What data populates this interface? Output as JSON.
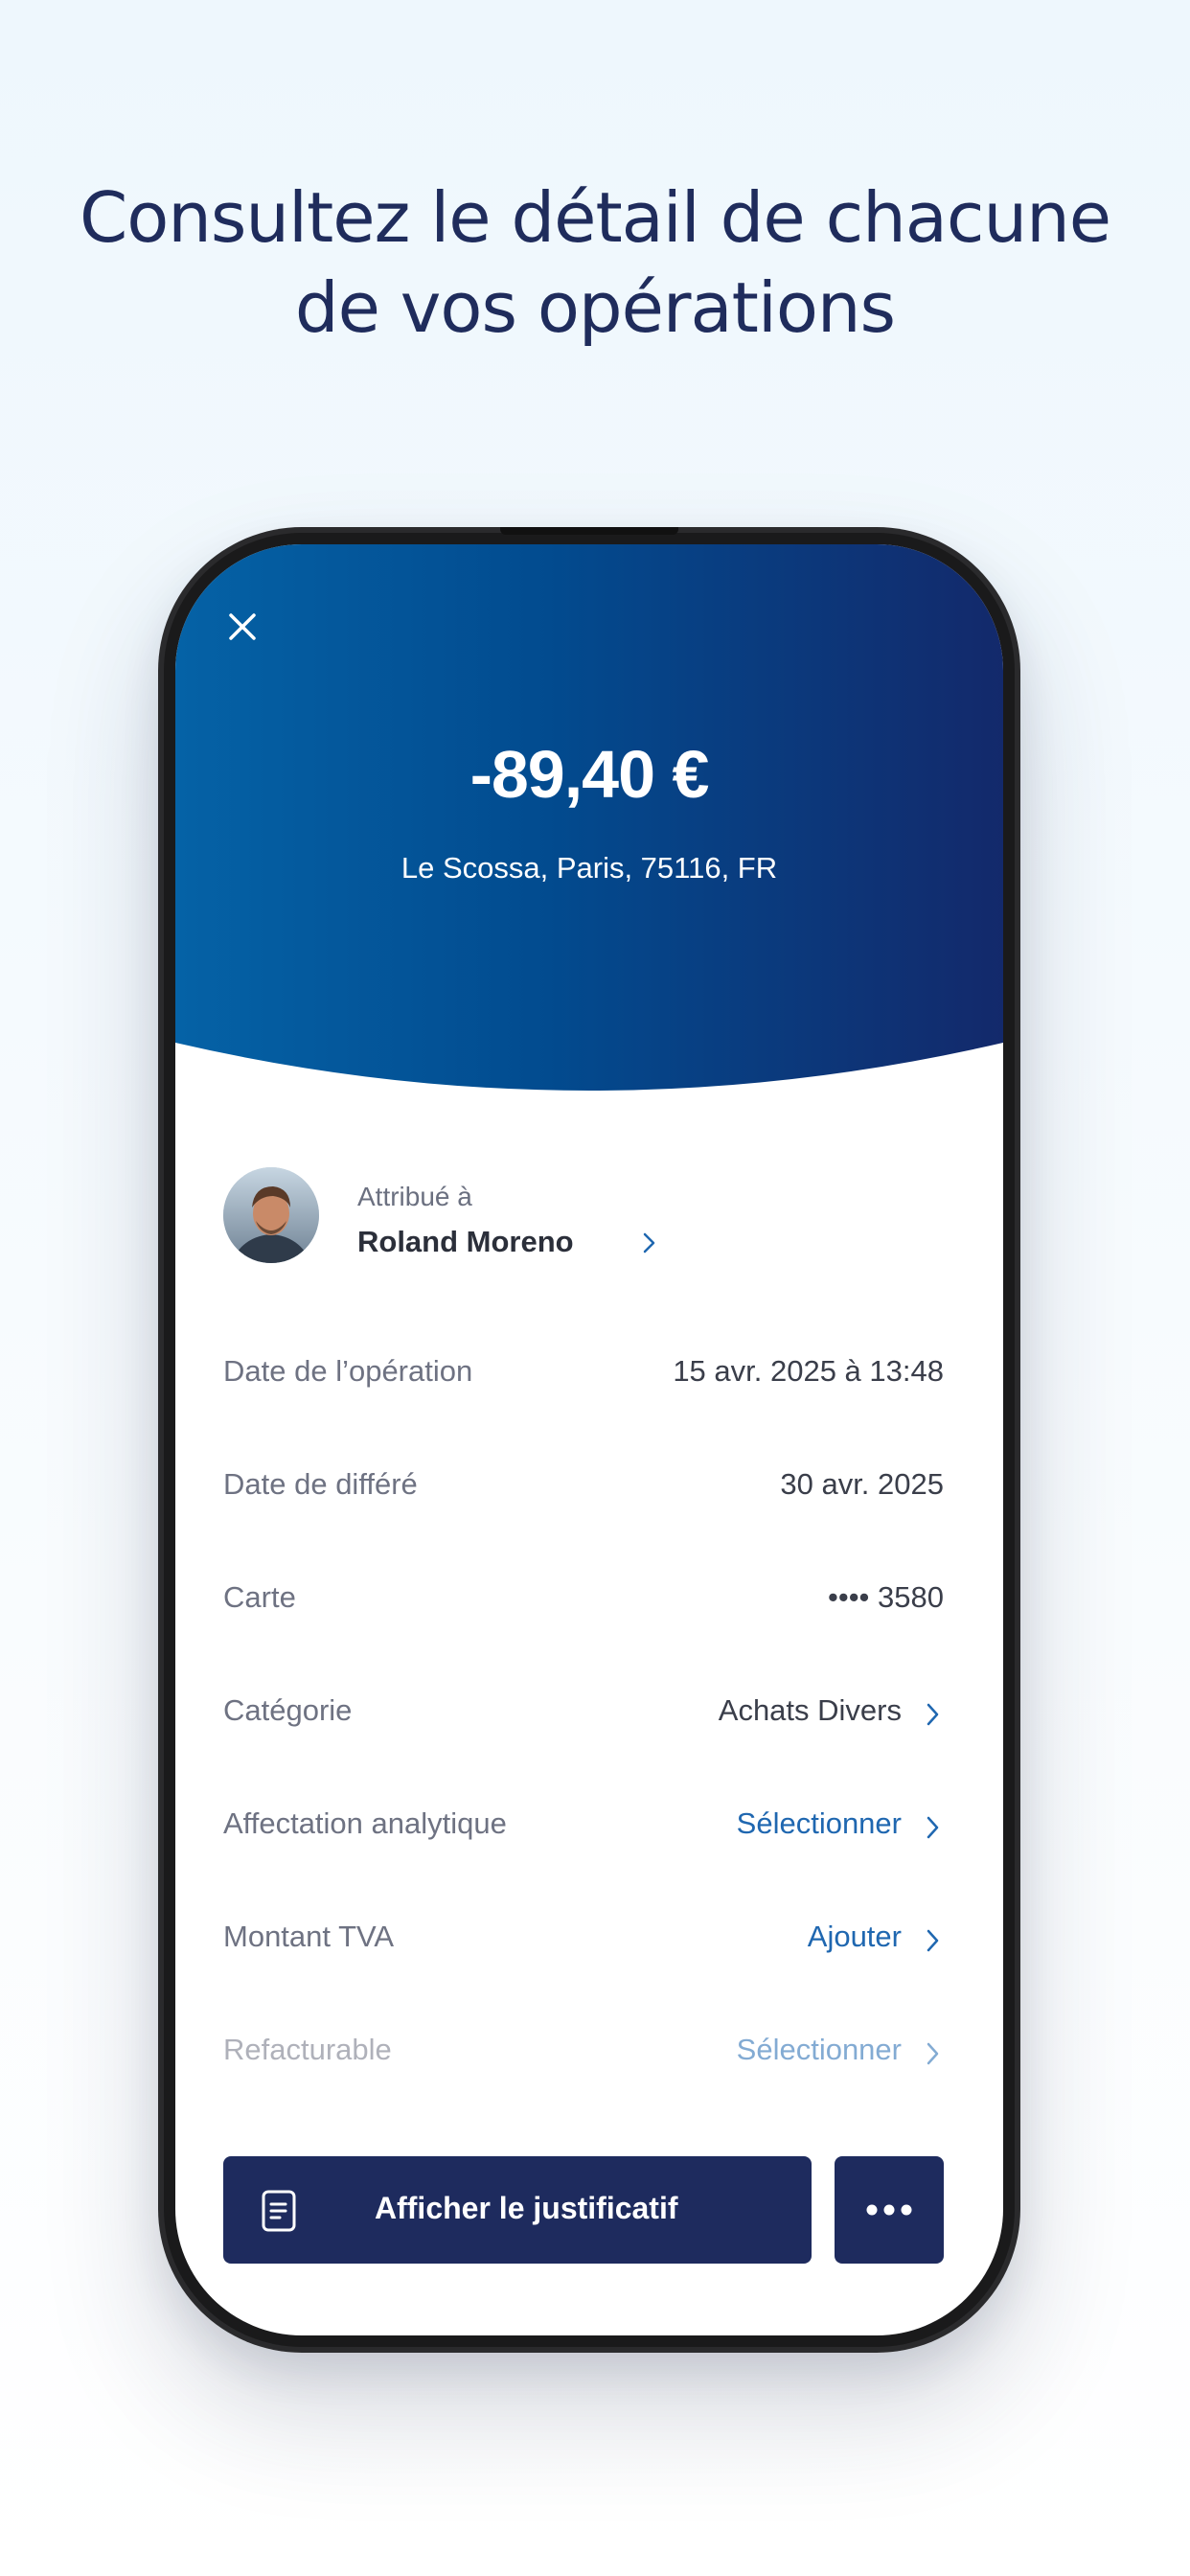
{
  "headline": {
    "line1": "Consultez le détail de chacune",
    "line2": "de vos opérations"
  },
  "transaction": {
    "amount": "-89,40 €",
    "merchant": "Le Scossa, Paris, 75116, FR"
  },
  "assigned": {
    "label": "Attribué à",
    "name": "Roland Moreno"
  },
  "rows": [
    {
      "label": "Date de l’opération",
      "value": "15 avr. 2025 à 13:48"
    },
    {
      "label": "Date de différé",
      "value": "30 avr. 2025"
    },
    {
      "label": "Carte",
      "value": "•••• 3580"
    },
    {
      "label": "Catégorie",
      "value": "Achats Divers"
    },
    {
      "label": "Affectation analytique",
      "value": "Sélectionner"
    },
    {
      "label": "Montant TVA",
      "value": "Ajouter"
    },
    {
      "label": "Refacturable",
      "value": "Sélectionner"
    }
  ],
  "actions": {
    "receipt_label": "Afficher le justificatif"
  },
  "colors": {
    "navy": "#1e2b5e",
    "link": "#1f67b0",
    "header_start": "#0562a6",
    "header_end": "#13296b"
  },
  "icons": [
    "close-icon",
    "chevron-right-icon",
    "document-icon",
    "more-dots-icon"
  ]
}
